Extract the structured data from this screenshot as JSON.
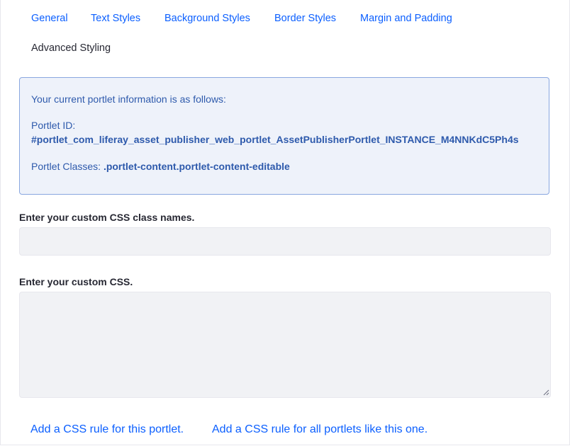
{
  "tabs": [
    {
      "label": "General",
      "active": false
    },
    {
      "label": "Text Styles",
      "active": false
    },
    {
      "label": "Background Styles",
      "active": false
    },
    {
      "label": "Border Styles",
      "active": false
    },
    {
      "label": "Margin and Padding",
      "active": false
    },
    {
      "label": "Advanced Styling",
      "active": true
    }
  ],
  "info": {
    "intro": "Your current portlet information is as follows:",
    "portlet_id_label": "Portlet ID:",
    "portlet_id_value": "#portlet_com_liferay_asset_publisher_web_portlet_AssetPublisherPortlet_INSTANCE_M4NNKdC5Ph4s",
    "portlet_classes_label": "Portlet Classes:",
    "portlet_classes_value": ".portlet-content.portlet-content-editable"
  },
  "form": {
    "class_names_label": "Enter your custom CSS class names.",
    "class_names_value": "",
    "custom_css_label": "Enter your custom CSS.",
    "custom_css_value": ""
  },
  "links": {
    "add_rule_this": "Add a CSS rule for this portlet.",
    "add_rule_all": "Add a CSS rule for all portlets like this one."
  },
  "colors": {
    "link": "#0b5fff",
    "info_background": "#eef2fa",
    "info_border": "#89a7e0",
    "info_text": "#2e5aac",
    "input_background": "#f1f2f5",
    "text": "#272833"
  }
}
